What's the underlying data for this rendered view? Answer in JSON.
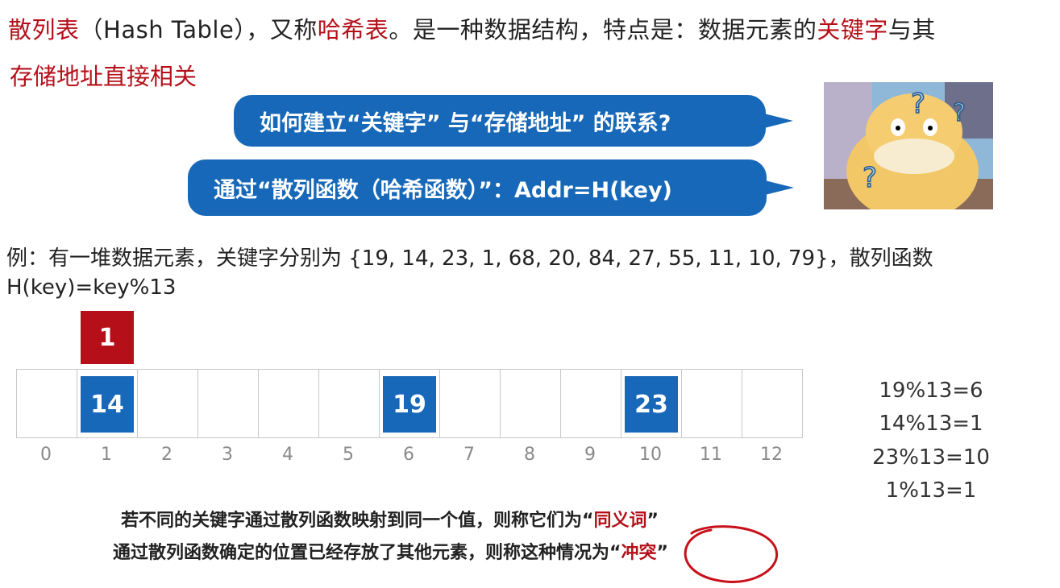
{
  "intro": {
    "term": "散列表",
    "text_a": "（Hash Table），又称",
    "alias": "哈希表",
    "text_b": "。是一种数据结构，特点是：数据元素的",
    "key": "关键字",
    "text_c": "与其",
    "line2": "存储地址直接相关"
  },
  "bubbles": {
    "question": "如何建立“关键字” 与“存储地址” 的联系?",
    "answer": "通过“散列函数（哈希函数）”：Addr=H(key)"
  },
  "example": {
    "line1": "例：有一堆数据元素，关键字分别为 {19, 14, 23, 1, 68, 20, 84, 27, 55, 11, 10, 79}，散列函数",
    "line2": "H(key)=key%13"
  },
  "table": {
    "indices": [
      "0",
      "1",
      "2",
      "3",
      "4",
      "5",
      "6",
      "7",
      "8",
      "9",
      "10",
      "11",
      "12"
    ],
    "cells": [
      "",
      "14",
      "",
      "",
      "",
      "",
      "19",
      "",
      "",
      "",
      "23",
      "",
      ""
    ],
    "overflow_value": "1"
  },
  "calculations": [
    "19%13=6",
    "14%13=1",
    "23%13=10",
    "1%13=1"
  ],
  "notes": {
    "synonym_a": "若不同的关键字通过散列函数映射到同一个值，则称它们为“",
    "synonym_word": "同义词",
    "synonym_b": "”",
    "conflict_a": "通过散列函数确定的位置已经存放了其他元素，则称这种情况为“",
    "conflict_word": "冲突",
    "conflict_b": "”"
  },
  "colors": {
    "accent_red": "#b5101a",
    "accent_blue": "#1768b8"
  },
  "icons": [
    "psyduck-image"
  ]
}
